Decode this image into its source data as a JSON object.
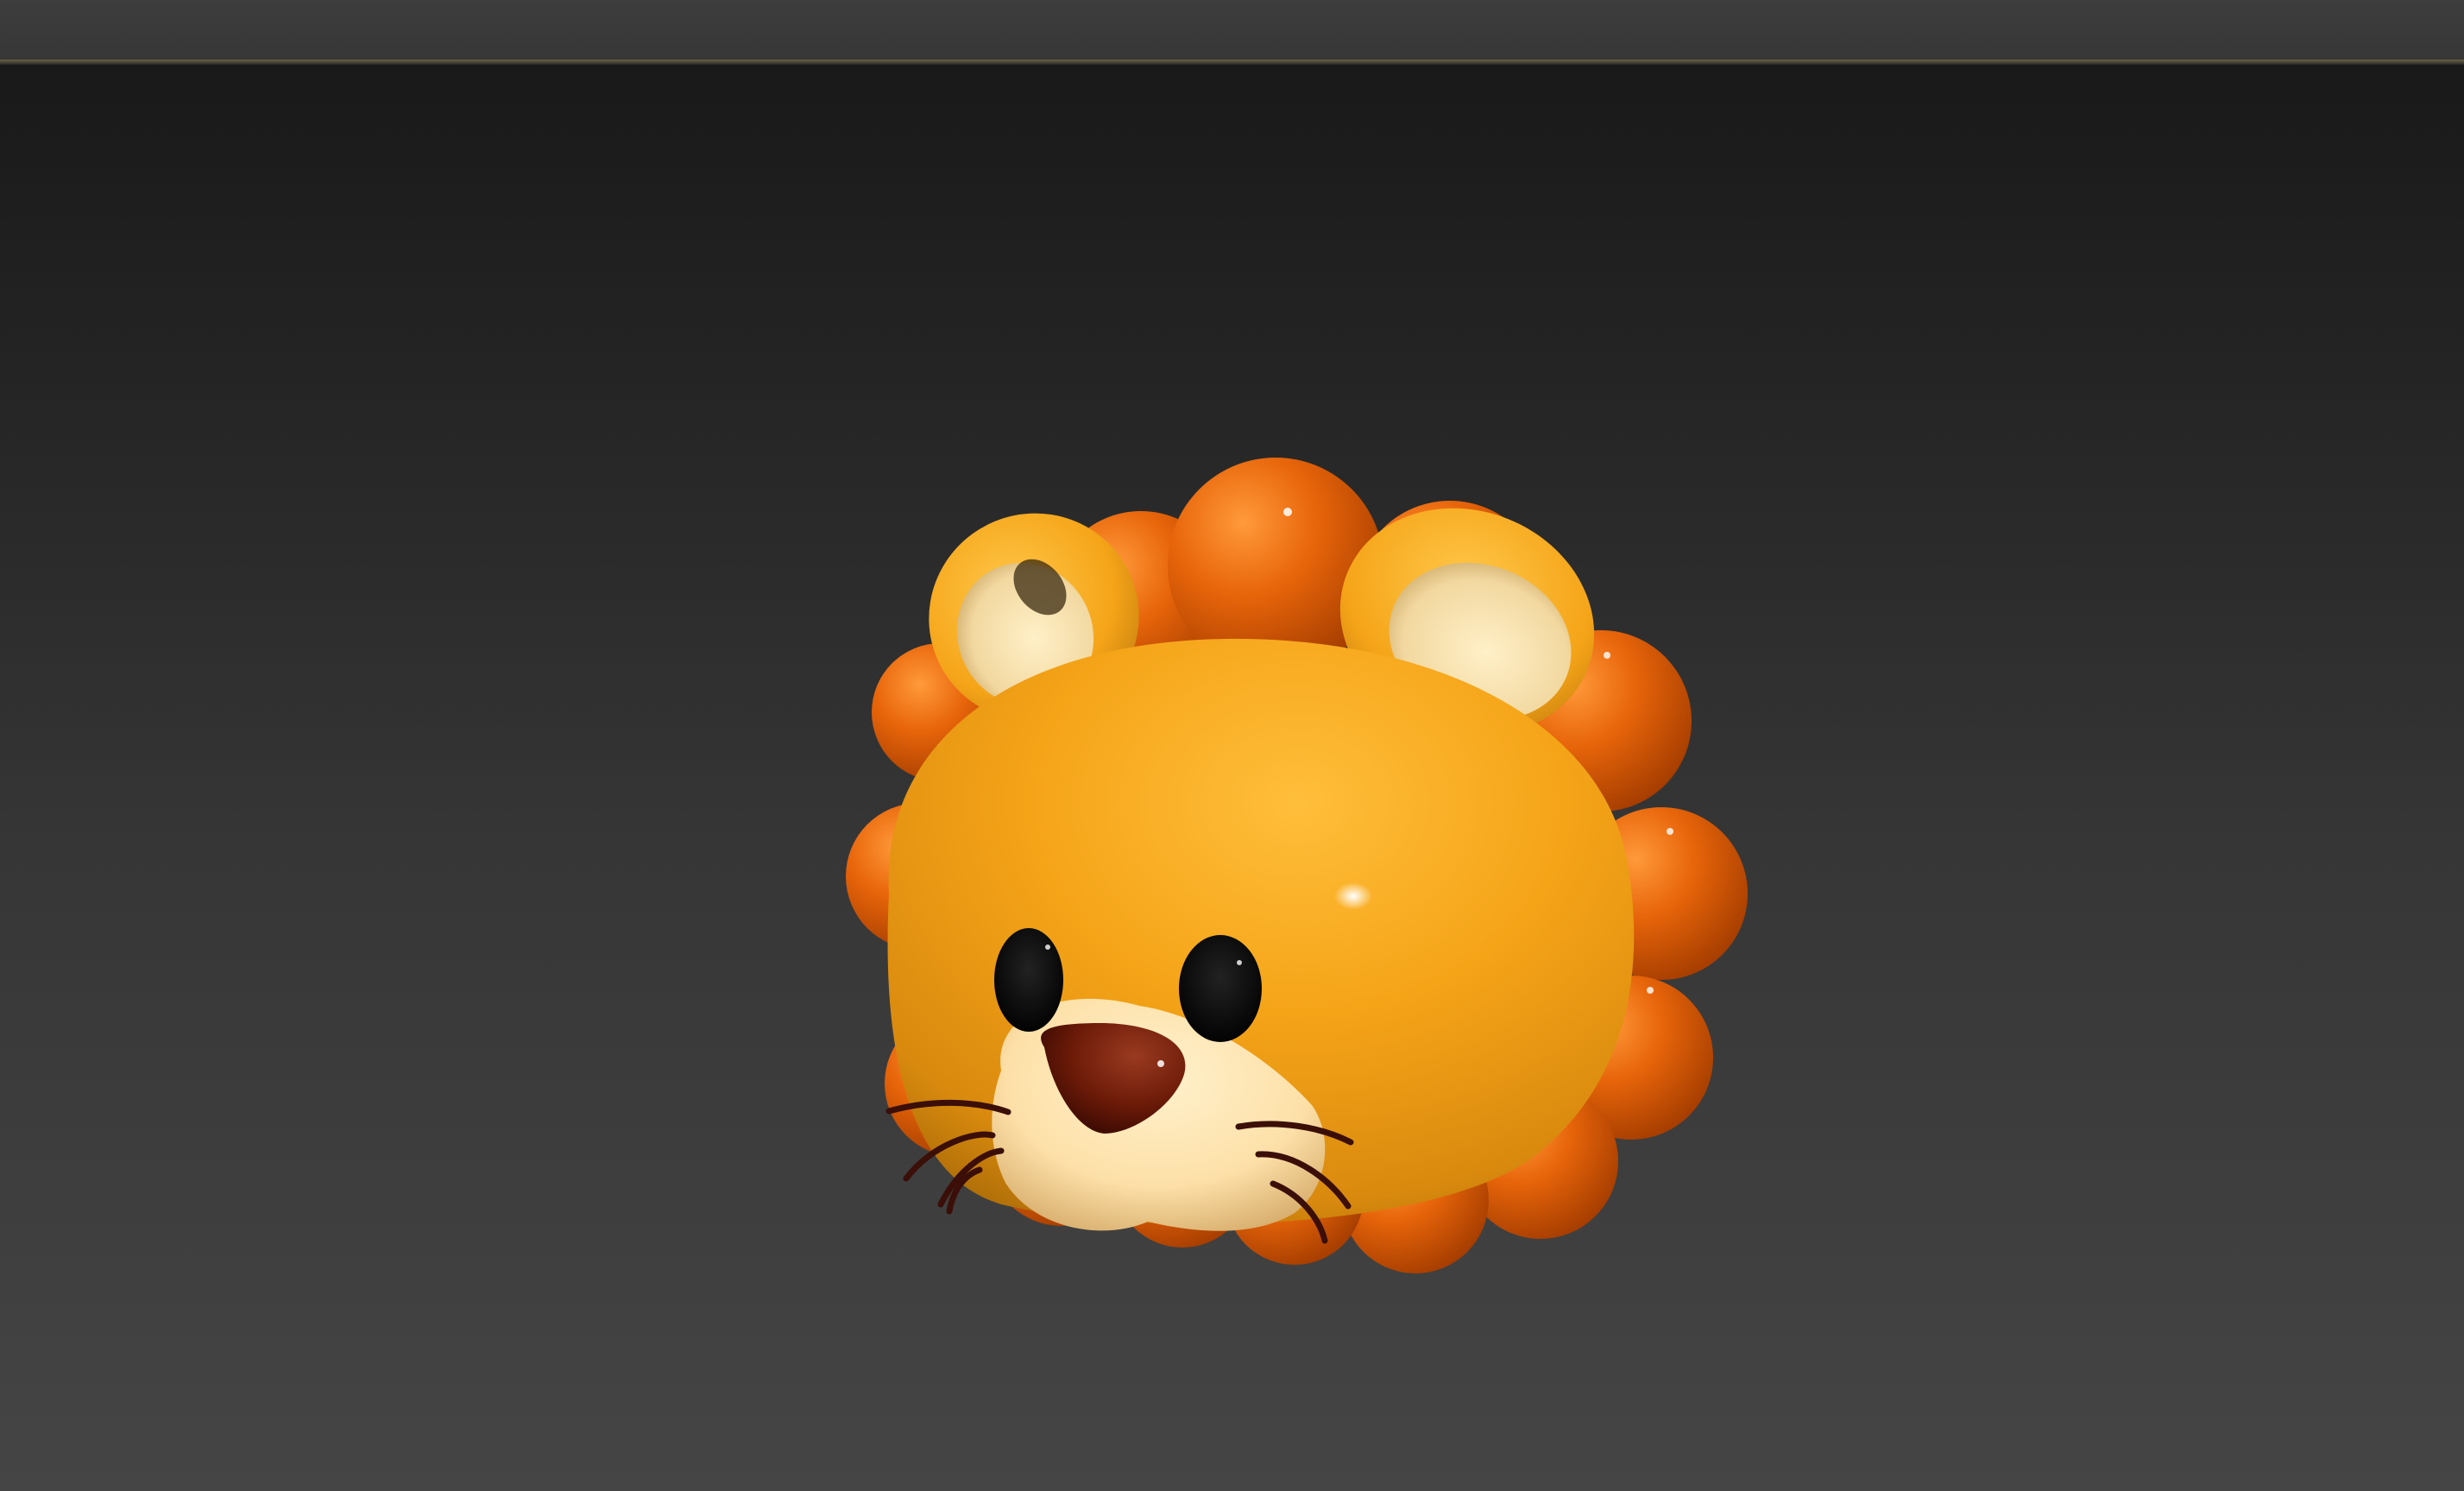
{
  "app": {
    "colors": {
      "topbar": "#3a3a3a",
      "viewport_top": "#191919",
      "viewport_bottom": "#454545",
      "mane": "#e8650a",
      "head": "#f5a418",
      "muzzle": "#fde0a8",
      "nose": "#6b1a08",
      "eye": "#0a0a0a",
      "whisker": "#3b0f08"
    }
  }
}
